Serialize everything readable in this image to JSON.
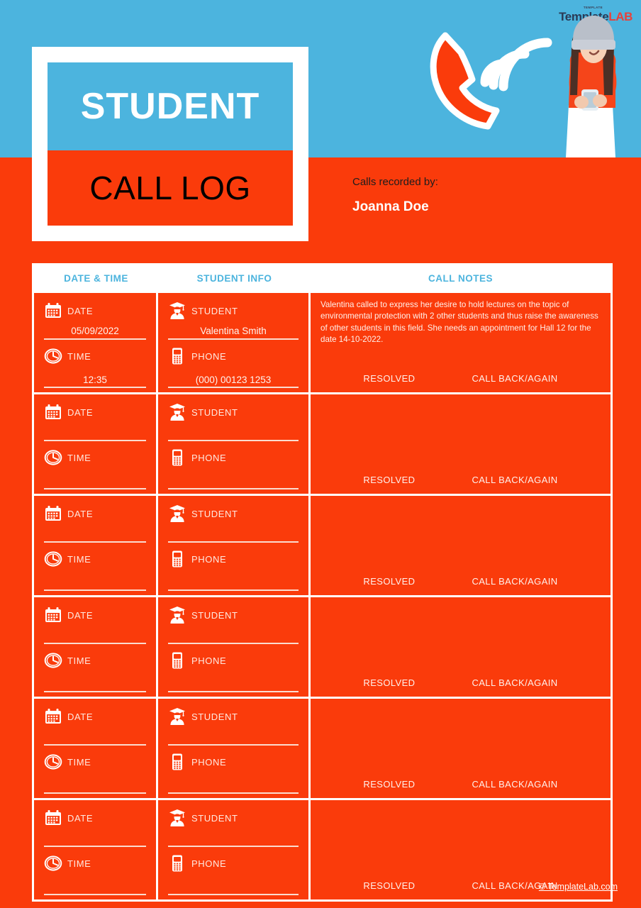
{
  "brand": {
    "logo_kicker": "TEMPLATE",
    "logo_name_1": "Template",
    "logo_name_2": "LAB",
    "color_blue": "#4CB4DE",
    "color_red": "#FA3B0B"
  },
  "title": {
    "line1": "STUDENT",
    "line2": "CALL LOG"
  },
  "recorded": {
    "label": "Calls recorded by:",
    "name": "Joanna Doe"
  },
  "table": {
    "headers": [
      "DATE & TIME",
      "STUDENT INFO",
      "CALL NOTES"
    ],
    "labels": {
      "date": "DATE",
      "time": "TIME",
      "student": "STUDENT",
      "phone": "PHONE",
      "resolved": "RESOLVED",
      "call_back": "CALL BACK/AGAIN"
    },
    "rows": [
      {
        "date": "05/09/2022",
        "time": "12:35",
        "student": "Valentina Smith",
        "phone": "(000) 00123 1253",
        "notes": "Valentina called to express her desire to hold lectures on the topic of environmental protection with 2 other students and thus raise the awareness of other students in this field. She needs an appointment for Hall 12 for the date 14-10-2022."
      },
      {
        "date": "",
        "time": "",
        "student": "",
        "phone": "",
        "notes": ""
      },
      {
        "date": "",
        "time": "",
        "student": "",
        "phone": "",
        "notes": ""
      },
      {
        "date": "",
        "time": "",
        "student": "",
        "phone": "",
        "notes": ""
      },
      {
        "date": "",
        "time": "",
        "student": "",
        "phone": "",
        "notes": ""
      },
      {
        "date": "",
        "time": "",
        "student": "",
        "phone": "",
        "notes": ""
      }
    ]
  },
  "footer": {
    "copyright": "© TemplateLab.com"
  }
}
